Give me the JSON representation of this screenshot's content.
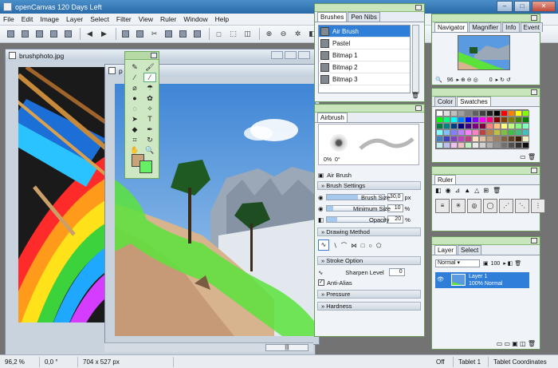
{
  "window": {
    "title": "openCanvas 120 Days Left"
  },
  "menu": [
    "File",
    "Edit",
    "Image",
    "Layer",
    "Select",
    "Filter",
    "View",
    "Ruler",
    "Window",
    "Help"
  ],
  "documents": {
    "photo_title": "brushphoto.jpg",
    "canvas_title": "p"
  },
  "brushes_panel": {
    "tabs": [
      "Brushes",
      "Pen Nibs"
    ],
    "items": [
      "Air Brush",
      "Pastel",
      "Bitmap 1",
      "Bitmap 2",
      "Bitmap 3"
    ],
    "selected": "Air Brush"
  },
  "airbrush_panel": {
    "tab": "Airbrush",
    "readout_a": "0%",
    "readout_b": "0°",
    "brush_name": "Air Brush",
    "brush_settings": "Brush Settings",
    "settings": [
      {
        "label": "Brush Size",
        "value": "30,0",
        "unit": "px",
        "fill": 0.55
      },
      {
        "label": "Minimum Size",
        "value": "10",
        "unit": "%",
        "fill": 0.12
      },
      {
        "label": "Opacity",
        "value": "20",
        "unit": "%",
        "fill": 0.18
      }
    ],
    "drawing_method": "Drawing Method",
    "stroke_option": "Stroke Option",
    "sharpen_label": "Sharpen Level",
    "sharpen_value": "0",
    "anti_alias": "Anti-Alias",
    "pressure": "Pressure",
    "hardness": "Hardness"
  },
  "navigator_panel": {
    "tabs": [
      "Navigator",
      "Magnifier",
      "Info",
      "Event"
    ],
    "zoom": "96",
    "angle": "0"
  },
  "color_panel": {
    "tabs": [
      "Color",
      "Swatches"
    ],
    "swatches": [
      "#ffffff",
      "#e0e0e0",
      "#c0c0c0",
      "#a0a0a0",
      "#808080",
      "#606060",
      "#404040",
      "#202020",
      "#000000",
      "#ff0000",
      "#ff8000",
      "#ffff00",
      "#80ff00",
      "#00ff00",
      "#00ff80",
      "#00ffff",
      "#0080ff",
      "#0000ff",
      "#8000ff",
      "#ff00ff",
      "#ff0080",
      "#800000",
      "#804000",
      "#808000",
      "#408000",
      "#008000",
      "#008040",
      "#008080",
      "#004080",
      "#000080",
      "#400080",
      "#800080",
      "#800040",
      "#ff8080",
      "#ffc080",
      "#ffff80",
      "#c0ff80",
      "#80ff80",
      "#80ffc0",
      "#80ffff",
      "#80c0ff",
      "#8080ff",
      "#c080ff",
      "#ff80ff",
      "#ff80c0",
      "#c04040",
      "#c08040",
      "#c0c040",
      "#80c040",
      "#40c040",
      "#40c080",
      "#40c0c0",
      "#4080c0",
      "#4040c0",
      "#8040c0",
      "#c040c0",
      "#c04080",
      "#ffe0c0",
      "#e0c0a0",
      "#c0a080",
      "#a08060",
      "#806040",
      "#604020",
      "#402000",
      "#f0f0c0",
      "#c0f0f0",
      "#c0c0f0",
      "#f0c0f0",
      "#f0c0c0",
      "#c0f0c0",
      "#e8e8e8",
      "#d0d0d0",
      "#b0b0b0",
      "#909090",
      "#707070",
      "#505050",
      "#303030",
      "#101010"
    ]
  },
  "ruler_panel": {
    "tab": "Ruler"
  },
  "layer_panel": {
    "tabs": [
      "Layer",
      "Select"
    ],
    "blend_mode": "Normal",
    "opacity": "100",
    "layers": [
      {
        "name": "Layer 1",
        "info": "100% Normal"
      }
    ]
  },
  "statusbar": {
    "zoom": "96,2 %",
    "angle": "0,0 °",
    "size": "704 x 527 px",
    "mode": "Off",
    "tablet": "Tablet 1",
    "coords": "Tablet Coordinates"
  }
}
